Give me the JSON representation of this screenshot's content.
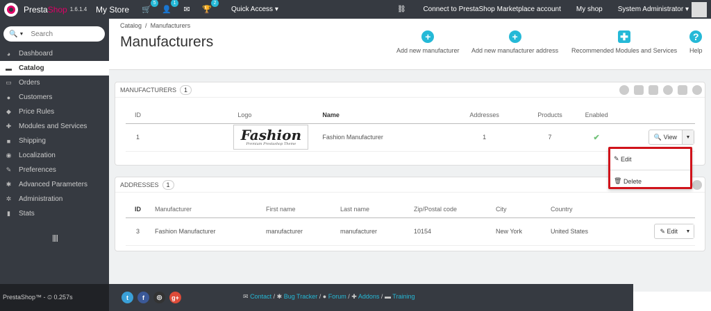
{
  "topbar": {
    "brand_main": "Presta",
    "brand_accent": "Shop",
    "version": "1.6.1.4",
    "store_name": "My Store",
    "cart_badge": "5",
    "customers_badge": "1",
    "trophy_badge": "2",
    "quick_access": "Quick Access",
    "marketplace": "Connect to PrestaShop Marketplace account",
    "my_shop": "My shop",
    "admin": "System Administrator"
  },
  "sidebar": {
    "search_placeholder": "Search",
    "items": [
      {
        "label": "Dashboard",
        "icon": "dashboard-icon"
      },
      {
        "label": "Catalog",
        "icon": "book-icon"
      },
      {
        "label": "Orders",
        "icon": "credit-card-icon"
      },
      {
        "label": "Customers",
        "icon": "user-icon"
      },
      {
        "label": "Price Rules",
        "icon": "tag-icon"
      },
      {
        "label": "Modules and Services",
        "icon": "puzzle-icon"
      },
      {
        "label": "Shipping",
        "icon": "truck-icon"
      },
      {
        "label": "Localization",
        "icon": "globe-icon"
      },
      {
        "label": "Preferences",
        "icon": "wrench-icon"
      },
      {
        "label": "Advanced Parameters",
        "icon": "cogs-icon"
      },
      {
        "label": "Administration",
        "icon": "cog-icon"
      },
      {
        "label": "Stats",
        "icon": "bar-chart-icon"
      }
    ]
  },
  "header": {
    "breadcrumb_1": "Catalog",
    "breadcrumb_sep": "/",
    "breadcrumb_2": "Manufacturers",
    "title": "Manufacturers",
    "toolbar": {
      "add_manufacturer": "Add new manufacturer",
      "add_address": "Add new manufacturer address",
      "recommended": "Recommended Modules and Services",
      "help": "Help"
    }
  },
  "manufacturers": {
    "heading": "Manufacturers",
    "count": "1",
    "columns": [
      "ID",
      "Logo",
      "Name",
      "Addresses",
      "Products",
      "Enabled"
    ],
    "rows": [
      {
        "id": "1",
        "logo_text": "Fashion",
        "logo_sub": "Premium Prestashop Theme",
        "name": "Fashion Manufacturer",
        "addresses": "1",
        "products": "7",
        "enabled": "✔",
        "action": "View"
      }
    ]
  },
  "dropdown": {
    "edit": "Edit",
    "delete": "Delete"
  },
  "addresses": {
    "heading": "Addresses",
    "count": "1",
    "columns": [
      "ID",
      "Manufacturer",
      "First name",
      "Last name",
      "Zip/Postal code",
      "City",
      "Country"
    ],
    "rows": [
      {
        "id": "3",
        "manufacturer": "Fashion Manufacturer",
        "first_name": "manufacturer",
        "last_name": "manufacturer",
        "zip": "10154",
        "city": "New York",
        "country": "United States",
        "action": "Edit"
      }
    ]
  },
  "footer": {
    "version": "PrestaShop™ - ⏲ 0.257s",
    "contact": "Contact",
    "bug_tracker": "Bug Tracker",
    "forum": "Forum",
    "addons": "Addons",
    "training": "Training",
    "sep": "/"
  },
  "colors": {
    "accent": "#25b9d7",
    "brand": "#df0067",
    "highlight": "#d0121a",
    "enabled": "#72c279"
  }
}
